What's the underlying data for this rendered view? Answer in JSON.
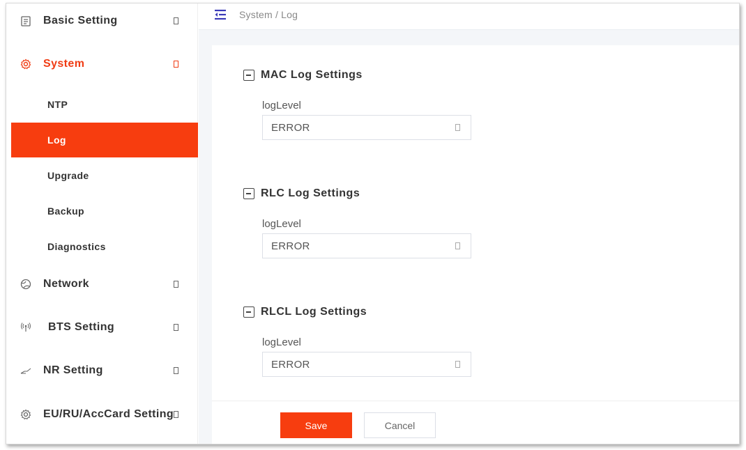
{
  "breadcrumb": "System / Log",
  "sidebar": {
    "items": [
      {
        "label": "Basic Setting",
        "icon": "document-icon"
      },
      {
        "label": "System",
        "icon": "gear-icon",
        "active": true
      },
      {
        "label": "Network",
        "icon": "globe-icon"
      },
      {
        "label": "BTS Setting",
        "icon": "antenna-icon"
      },
      {
        "label": "NR Setting",
        "icon": "signal-icon"
      },
      {
        "label": "EU/RU/AccCard Setting",
        "icon": "gear-icon"
      }
    ],
    "system_subitems": [
      {
        "label": "NTP"
      },
      {
        "label": "Log",
        "selected": true
      },
      {
        "label": "Upgrade"
      },
      {
        "label": "Backup"
      },
      {
        "label": "Diagnostics"
      }
    ]
  },
  "sections": [
    {
      "title": "MAC Log Settings",
      "field_label": "logLevel",
      "value": "ERROR"
    },
    {
      "title": "RLC Log Settings",
      "field_label": "logLevel",
      "value": "ERROR"
    },
    {
      "title": "RLCL Log Settings",
      "field_label": "logLevel",
      "value": "ERROR"
    }
  ],
  "footer": {
    "save_label": "Save",
    "cancel_label": "Cancel"
  },
  "colors": {
    "accent": "#f73d0f",
    "active_text": "#f03c14",
    "background": "#f4f6f9"
  }
}
